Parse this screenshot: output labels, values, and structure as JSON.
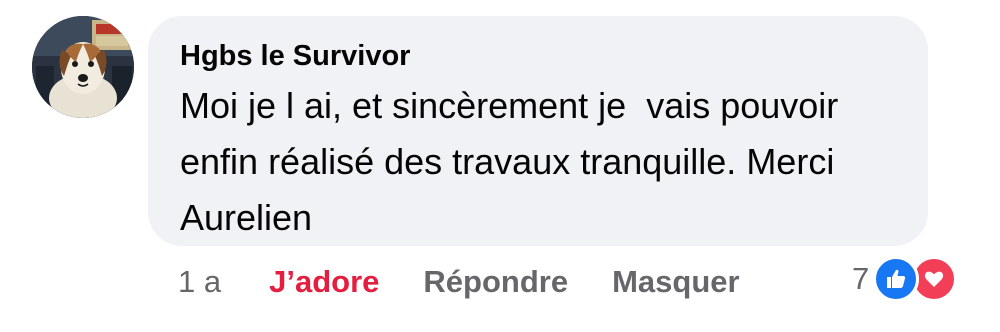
{
  "comment": {
    "author": "Hgbs le Survivor",
    "text": "Moi je l ai, et sincèrement je  vais pouvoir enfin réalisé des travaux tranquille. Merci Aurelien",
    "avatar_icon": "dog-portrait-avatar"
  },
  "actions": {
    "time": "1 a",
    "love_label": "J’adore",
    "reply_label": "Répondre",
    "hide_label": "Masquer"
  },
  "reactions": {
    "count": "7",
    "icons": [
      "like-icon",
      "love-icon"
    ],
    "colors": {
      "like": "#1877f2",
      "love": "#f33e58",
      "love_text": "#e41e3f"
    }
  }
}
